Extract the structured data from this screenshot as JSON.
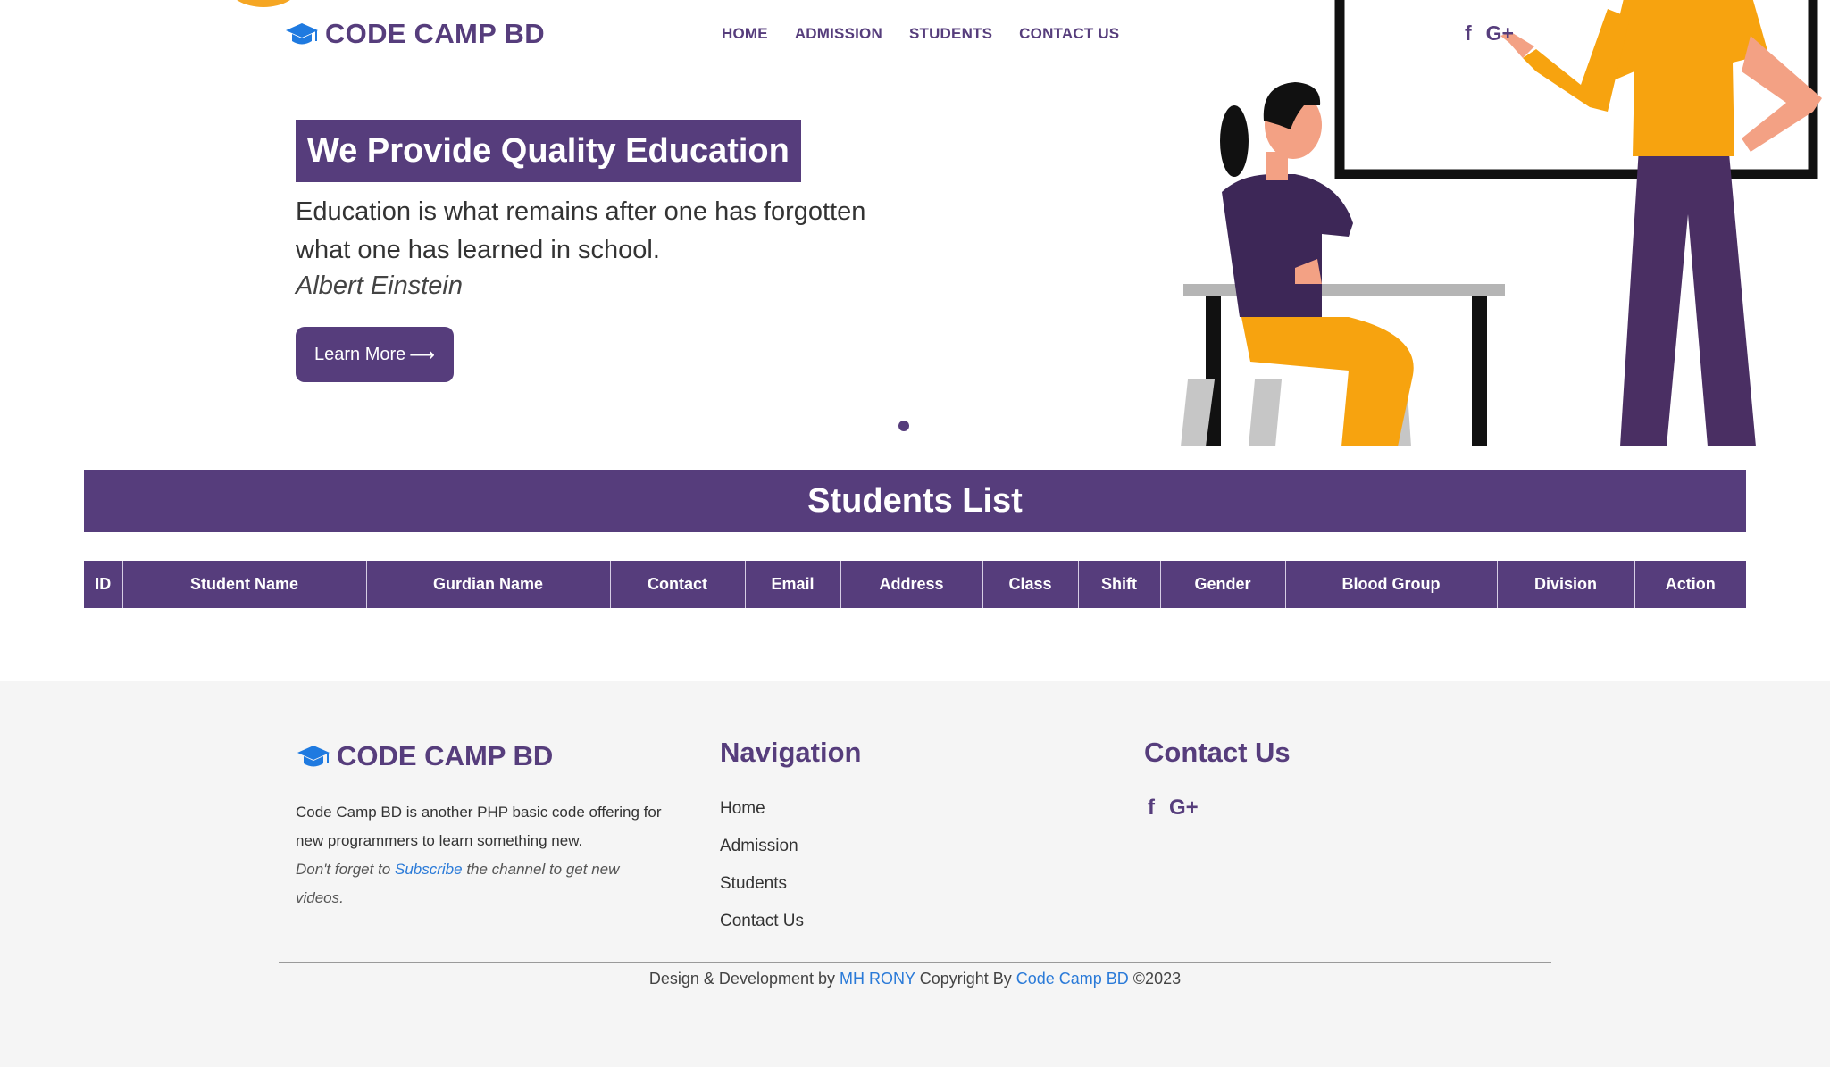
{
  "header": {
    "brand": "CODE CAMP BD",
    "nav": [
      "HOME",
      "ADMISSION",
      "STUDENTS",
      "CONTACT US"
    ],
    "social": {
      "facebook": "f",
      "google_plus": "G+"
    }
  },
  "hero": {
    "title": "We Provide Quality Education",
    "quote": "Education is what remains after one has forgotten what one has learned in school.",
    "author": "Albert Einstein",
    "button_label": "Learn More",
    "button_arrow": "⟶"
  },
  "students": {
    "title": "Students List",
    "columns": [
      "ID",
      "Student Name",
      "Gurdian Name",
      "Contact",
      "Email",
      "Address",
      "Class",
      "Shift",
      "Gender",
      "Blood Group",
      "Division",
      "Action"
    ]
  },
  "footer": {
    "brand": "CODE CAMP BD",
    "about_line1": "Code Camp BD is another PHP basic code offering for new programmers to learn something new.",
    "about_pre": "Don't forget to ",
    "about_link": "Subscribe",
    "about_post": " the channel to get new videos.",
    "nav_title": "Navigation",
    "nav_items": [
      "Home",
      "Admission",
      "Students",
      "Contact Us"
    ],
    "contact_title": "Contact Us",
    "social": {
      "facebook": "f",
      "google_plus": "G+"
    },
    "copy_pre": "Design & Development by ",
    "copy_author": "MH RONY",
    "copy_mid": " Copyright By ",
    "copy_brand": "Code Camp BD",
    "copy_post": " ©2023"
  },
  "colors": {
    "primary": "#563d7c",
    "accent_blue": "#2a7ad8",
    "cap_icon": "#1f7ae0",
    "footer_bg": "#f5f5f5",
    "orange": "#f7a30f"
  },
  "icons": [
    "graduation-cap-icon",
    "facebook-icon",
    "google-plus-icon",
    "arrow-right-icon"
  ]
}
